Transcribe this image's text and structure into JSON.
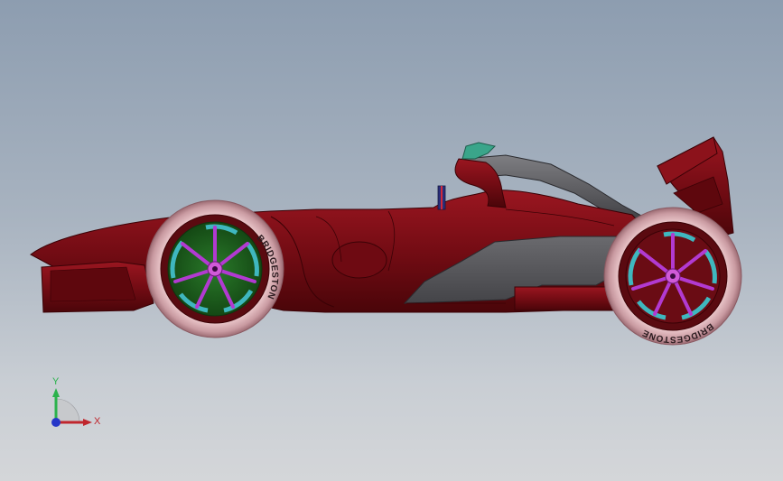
{
  "model": {
    "tire_brand_front": "BRIDGESTONE",
    "tire_brand_rear": "BRIDGESTONE"
  },
  "triad": {
    "x_label": "X",
    "y_label": "Y",
    "x_color": "#c0262d",
    "y_color": "#2bb24c",
    "z_color": "#2637c8"
  },
  "colors": {
    "body": "#7a0d14",
    "body_dark": "#4e0509",
    "sidepod_gray": "#5a5a5e",
    "rim_green": "#1e5a1e",
    "spoke_purple": "#b23ad1",
    "brake_cyan": "#3fb7bf",
    "tire": "#d9aab0",
    "helmet_green": "#3aa58a",
    "background_top": "#8d9db0",
    "background_bottom": "#d4d6d9"
  }
}
